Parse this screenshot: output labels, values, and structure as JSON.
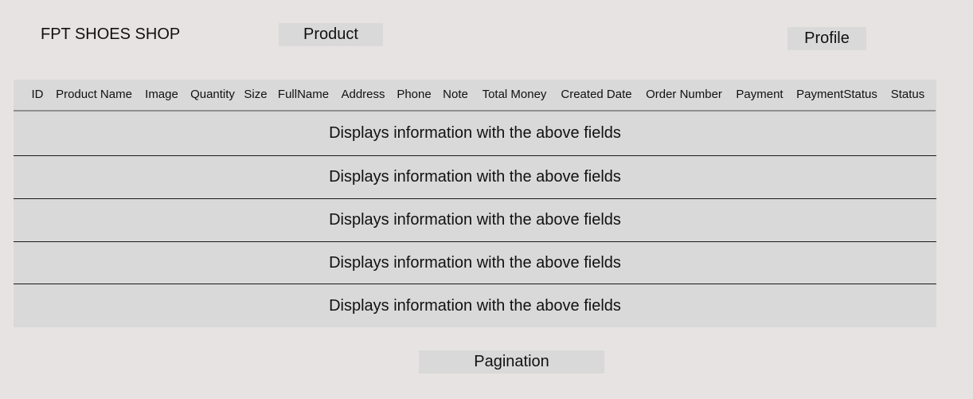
{
  "header": {
    "brand": "FPT SHOES SHOP",
    "product_label": "Product",
    "profile_label": "Profile"
  },
  "table": {
    "columns": [
      "ID",
      "Product Name",
      "Image",
      "Quantity",
      "Size",
      "FullName",
      "Address",
      "Phone",
      "Note",
      "Total Money",
      "Created Date",
      "Order Number",
      "Payment",
      "PaymentStatus",
      "Status"
    ],
    "rows": [
      "Displays information with the above fields",
      "Displays information with the above fields",
      "Displays information with the above fields",
      "Displays information with the above fields",
      "Displays information with the above fields"
    ]
  },
  "pagination": {
    "label": "Pagination"
  }
}
